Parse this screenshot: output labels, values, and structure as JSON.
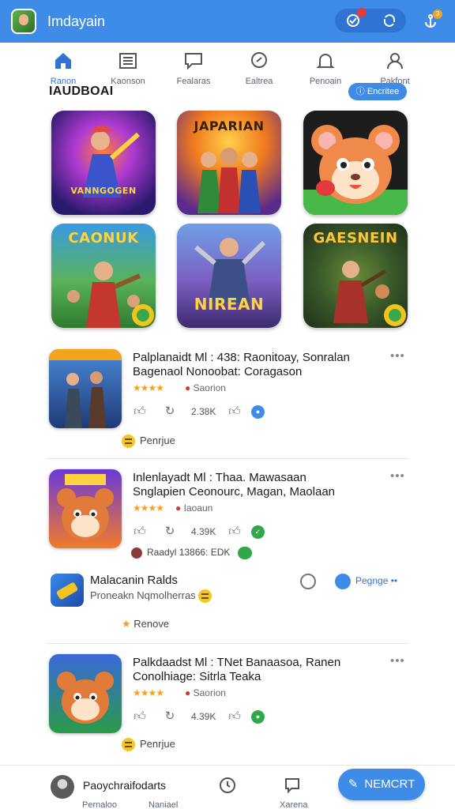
{
  "app": {
    "title": "Imdayain"
  },
  "top_icons": {
    "badge_count": "3"
  },
  "nav": [
    {
      "label": "Ranon",
      "icon": "home-icon"
    },
    {
      "label": "Kaonson",
      "icon": "list-icon"
    },
    {
      "label": "Fealaras",
      "icon": "chat-icon"
    },
    {
      "label": "Ealtrea",
      "icon": "search-icon"
    },
    {
      "label": "Penoain",
      "icon": "bell-icon"
    },
    {
      "label": "Pakfont",
      "icon": "profile-icon"
    }
  ],
  "section": {
    "title": "IAUDBOAI",
    "button": "Encritee"
  },
  "tiles": [
    {
      "caption": "VANNGOGEN"
    },
    {
      "caption": "JAPARIAN"
    },
    {
      "caption": ""
    },
    {
      "caption": "CAONUK"
    },
    {
      "caption": "NIREAN"
    },
    {
      "caption": "GAESNEIN"
    }
  ],
  "posts": [
    {
      "line1": "Palplanaidt Ml : 438: Raonitoay, Sonralan",
      "line2": "Bagenaol Nonoobat: Coragason",
      "stars": "★★★★",
      "rating": "Saorion",
      "count1": "2.38K",
      "footer": "Penrjue"
    },
    {
      "line1": "Inlenlayadt Ml : Thaa. Mawasaan",
      "line2": "Snglapien Ceonourc, Magan, Maolaan",
      "stars": "★★★★",
      "rating": "Iaoaun",
      "count1": "4.39K",
      "footer_meta": "Raadyl  13866: EDK"
    },
    {
      "line1": "Palkdaadst Ml : TNet Banaasoa, Ranen",
      "line2": "Conolhiage: Sitrla Teaka",
      "stars": "★★★★",
      "rating": "Saorion",
      "count1": "4.39K",
      "footer": "Penrjue"
    }
  ],
  "mini_post": {
    "title": "Malacanin Ralds",
    "subtitle": "Proneakn Nqmolherras",
    "action": "Pegnge",
    "footer": "Renove"
  },
  "bottom": {
    "name": "Paoychraifodarts",
    "labels": [
      "Pernaloo",
      "Naniael",
      "Xarena"
    ],
    "button": "NEMCRT"
  }
}
